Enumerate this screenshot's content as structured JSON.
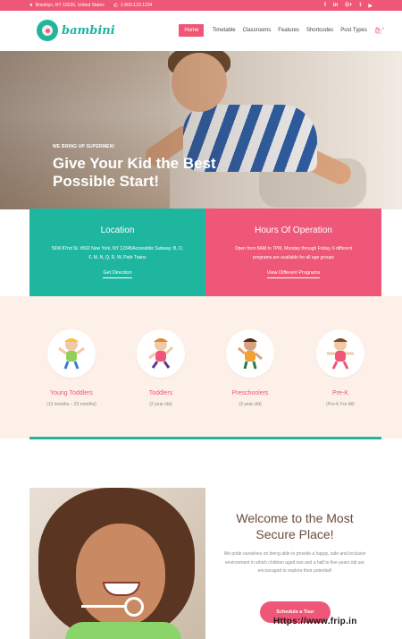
{
  "topbar": {
    "address": "Brooklyn, NY 10036, United States",
    "phone": "1-800-123-1234",
    "social": [
      {
        "icon": "facebook-icon",
        "glyph": "f"
      },
      {
        "icon": "linkedin-icon",
        "glyph": "in"
      },
      {
        "icon": "google-plus-icon",
        "glyph": "G+"
      },
      {
        "icon": "twitter-icon",
        "glyph": "t"
      },
      {
        "icon": "youtube-icon",
        "glyph": "▶"
      }
    ]
  },
  "header": {
    "logo_text": "bambini",
    "nav": [
      "Home",
      "Timetable",
      "Classrooms",
      "Features",
      "Shortcodes",
      "Post Types"
    ],
    "cart_count": "0"
  },
  "hero": {
    "subtitle": "WE BRING UP SUPERMEN!",
    "title": "Give Your Kid the Best Possible Start!"
  },
  "info": {
    "location": {
      "title": "Location",
      "text": "56W 87nd St. #502 New York, NY 12345Accessible Subway: B, D, F, M, N, Q, R, W, Path Trains",
      "link": "Get Direction"
    },
    "hours": {
      "title": "Hours Of Operation",
      "text": "Open from 8AM to 7PM, Monday through Friday. 6 different programs are available for all age groups",
      "link": "View Different Programs"
    }
  },
  "programs": [
    {
      "name": "Young Toddlers",
      "age": "(12 months – 23 months)"
    },
    {
      "name": "Toddlers",
      "age": "(2 year old)"
    },
    {
      "name": "Preschoolers",
      "age": "(3 year old)"
    },
    {
      "name": "Pre-K",
      "age": "(Pre-K For All)"
    }
  ],
  "welcome": {
    "title": "Welcome to the Most Secure Place!",
    "text": "We pride ourselves on being able to provide a happy, safe and inclusive environment in which children aged two and a half to five years old are encouraged to explore their potential!",
    "button": "Schedule a Tour"
  },
  "watermark": "Https://www.frip.in",
  "colors": {
    "teal": "#1fb6a0",
    "pink": "#ee5777",
    "cream": "#fdf0e9"
  }
}
